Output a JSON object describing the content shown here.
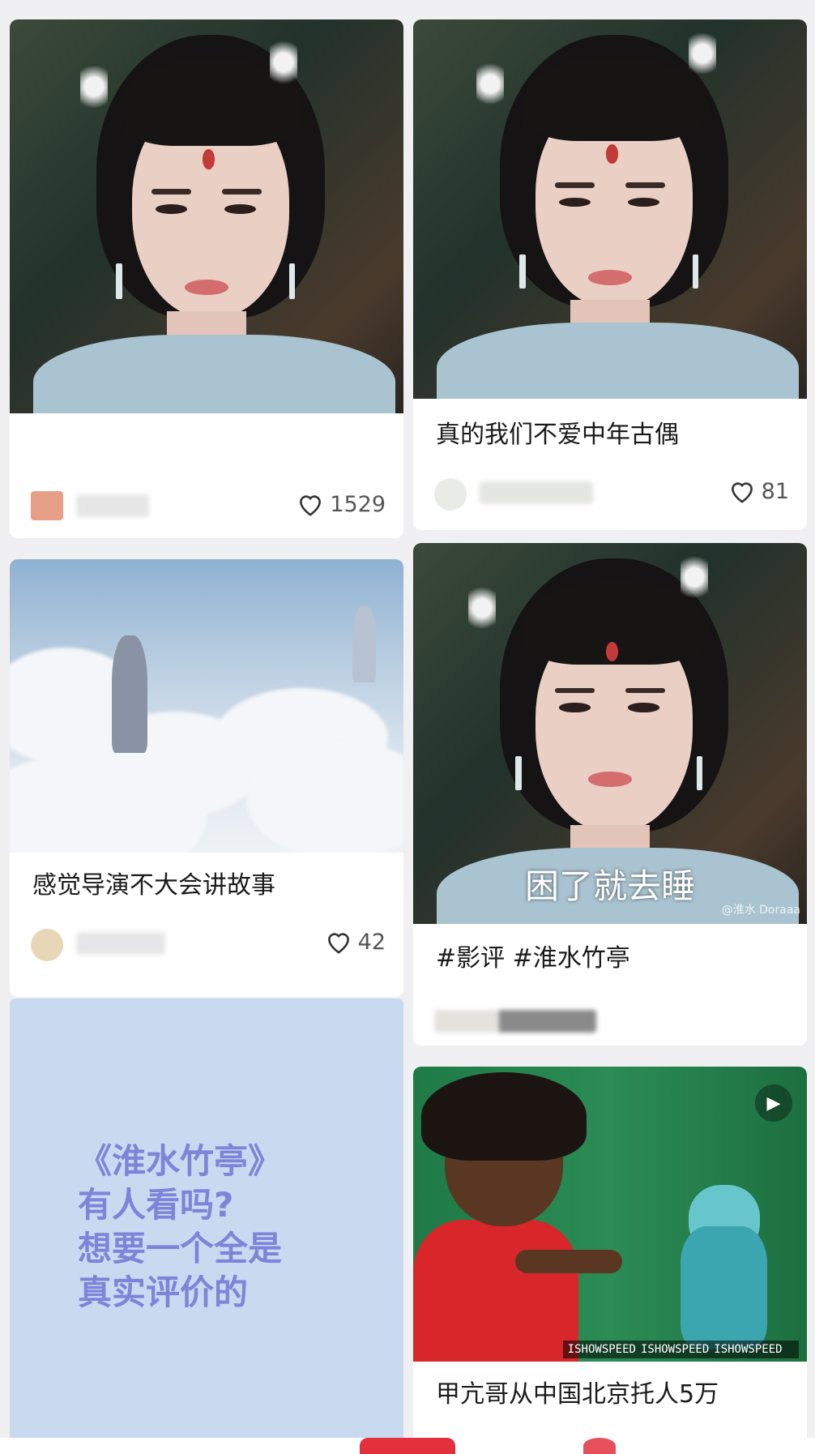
{
  "feed": {
    "cards": [
      {
        "title": "",
        "likes": "1529"
      },
      {
        "title": "真的我们不爱中年古偶",
        "likes": "81"
      },
      {
        "title": "感觉导演不大会讲故事",
        "likes": "42"
      },
      {
        "title": "#影评 #淮水竹亭",
        "overlay_caption": "困了就去睡",
        "watermark": "@淮水 Doraaa"
      },
      {
        "title": "",
        "cover_text": "《淮水竹亭》\n有人看吗?\n想要一个全是\n真实评价的"
      },
      {
        "title": "甲亢哥从中国北京托人5万",
        "handles": [
          "ISHOWSPEED",
          "ISHOWSPEED",
          "ISHOWSPEED"
        ]
      }
    ]
  },
  "icons": {
    "like": "heart-outline-icon",
    "play": "play-icon"
  },
  "colors": {
    "cover_bg": "#c9daf0",
    "cover_text": "#7d85d8",
    "accent": "#e3303d"
  }
}
